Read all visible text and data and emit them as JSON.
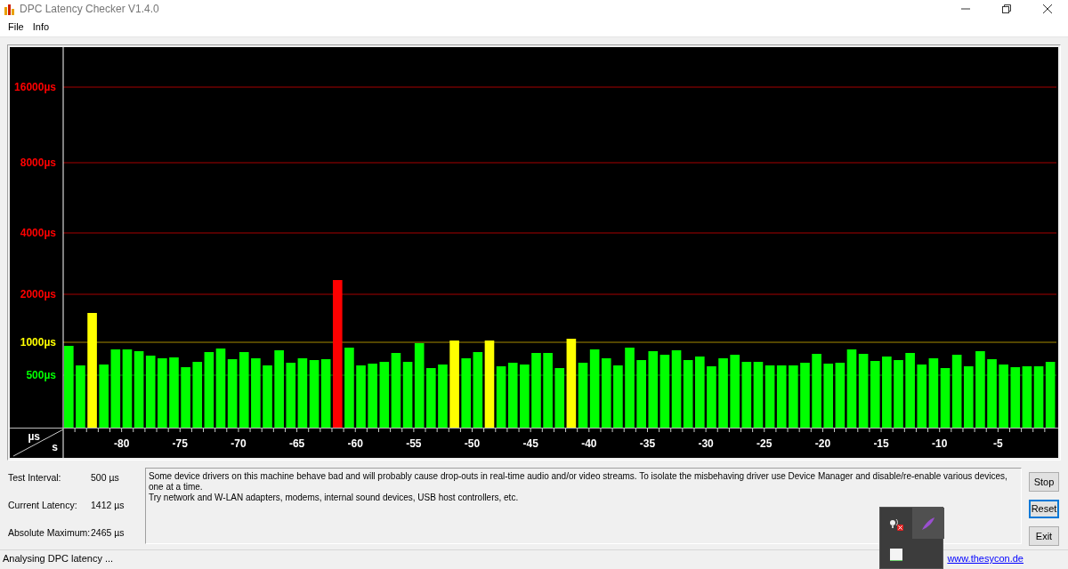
{
  "window": {
    "title": "DPC Latency Checker V1.4.0"
  },
  "menu": [
    {
      "label": "File"
    },
    {
      "label": "Info"
    }
  ],
  "chart": {
    "y_axis_labels": [
      {
        "label": "16000µs",
        "color": "#ff0000"
      },
      {
        "label": "8000µs",
        "color": "#ff0000"
      },
      {
        "label": "4000µs",
        "color": "#ff0000"
      },
      {
        "label": "2000µs",
        "color": "#ff0000"
      },
      {
        "label": "1000µs",
        "color": "#ffff00"
      },
      {
        "label": "500µs",
        "color": "#00ff00"
      }
    ],
    "x_axis_labels": [
      "-80",
      "-75",
      "-70",
      "-65",
      "-60",
      "-55",
      "-50",
      "-45",
      "-40",
      "-35",
      "-30",
      "-25",
      "-20",
      "-15",
      "-10",
      "-5"
    ],
    "y_unit": "µs",
    "x_unit": "s"
  },
  "stats": [
    {
      "label": "Test Interval:",
      "value": "500 µs"
    },
    {
      "label": "Current Latency:",
      "value": "1412 µs"
    },
    {
      "label": "Absolute Maximum:",
      "value": "2465 µs"
    }
  ],
  "message": "Some device drivers on this machine behave bad and will probably cause drop-outs in real-time audio and/or video streams. To isolate the misbehaving driver use Device Manager and disable/re-enable various devices, one at a time.\nTry network and W-LAN adapters, modems, internal sound devices, USB host controllers, etc.",
  "buttons": [
    {
      "label": "Stop",
      "focused": false
    },
    {
      "label": "Reset",
      "focused": true
    },
    {
      "label": "Exit",
      "focused": false
    }
  ],
  "status_bar": {
    "text": "Analysing DPC latency ...",
    "link": "www.thesycon.de"
  }
}
